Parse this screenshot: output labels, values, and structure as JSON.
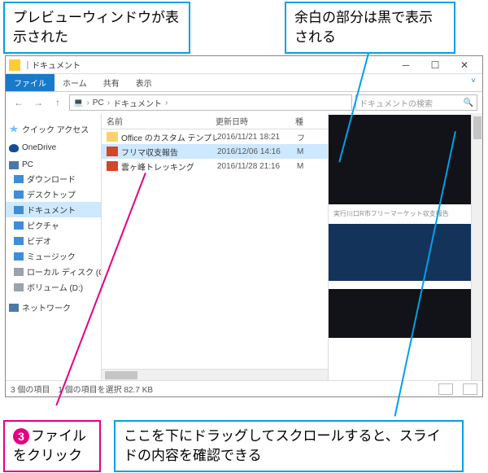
{
  "callouts": {
    "top_left": "プレビューウィンドウが表示された",
    "top_right": "余白の部分は黒で表示される",
    "bottom_left_step": "3",
    "bottom_left": "ファイルをクリック",
    "bottom_right": "ここを下にドラッグしてスクロールすると、スライドの内容を確認できる"
  },
  "window": {
    "title": "ドキュメント",
    "tabs": {
      "file": "ファイル",
      "home": "ホーム",
      "share": "共有",
      "view": "表示"
    },
    "address": {
      "pc": "PC",
      "folder": "ドキュメント"
    },
    "search_placeholder": "ドキュメントの検索",
    "columns": {
      "name": "名前",
      "date": "更新日時",
      "type": "種"
    },
    "nav": {
      "quick": "クイック アクセス",
      "onedrive": "OneDrive",
      "pc": "PC",
      "downloads": "ダウンロード",
      "desktop": "デスクトップ",
      "documents": "ドキュメント",
      "pictures": "ピクチャ",
      "videos": "ビデオ",
      "music": "ミュージック",
      "cdrive": "ローカル ディスク (C:)",
      "ddrive": "ボリューム (D:)",
      "network": "ネットワーク"
    },
    "files": [
      {
        "name": "Office のカスタム テンプレート",
        "date": "2016/11/21 18:21",
        "type": "フ"
      },
      {
        "name": "フリマ収支報告",
        "date": "2016/12/06 14:16",
        "type": "M"
      },
      {
        "name": "雲ヶ峰トレッキング",
        "date": "2016/11/28 21:16",
        "type": "M"
      }
    ],
    "preview_caption": "実行川口R市フリーマーケット収支報告",
    "status": {
      "count": "3 個の項目",
      "sel": "1 個の項目を選択 82.7 KB"
    }
  }
}
